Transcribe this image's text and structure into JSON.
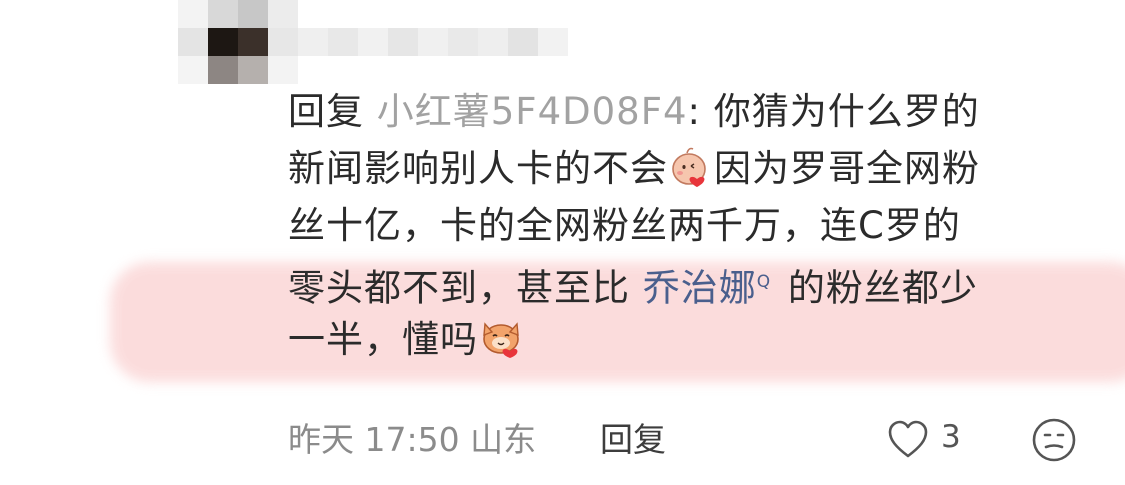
{
  "comment": {
    "reply_prefix": "回复",
    "reply_to_user": "小红薯5F4D08F4",
    "colon": ":",
    "line1_text": " 你猜为什么罗的",
    "line2_a": "新闻影响别人卡的不会",
    "line2_b": "因为罗哥全网粉",
    "line3": "丝十亿，卡的全网粉丝两千万，连C罗的",
    "line4_a": "零头都不到，甚至比 ",
    "mention": "乔治娜",
    "search_mark": "Q",
    "line4_b": " 的粉丝都少",
    "line5": "一半，懂吗",
    "emoji_1": "blushing-face-heart-emoji",
    "emoji_2": "cat-face-heart-emoji"
  },
  "footer": {
    "time": "昨天 17:50",
    "location": "山东",
    "reply_label": "回复",
    "like_count": "3",
    "like_icon": "heart-outline-icon",
    "react_icon": "face-reaction-icon"
  },
  "colors": {
    "highlight": "#fbd9d9",
    "mention": "#4a5f8d",
    "muted": "#a2a2a2"
  }
}
